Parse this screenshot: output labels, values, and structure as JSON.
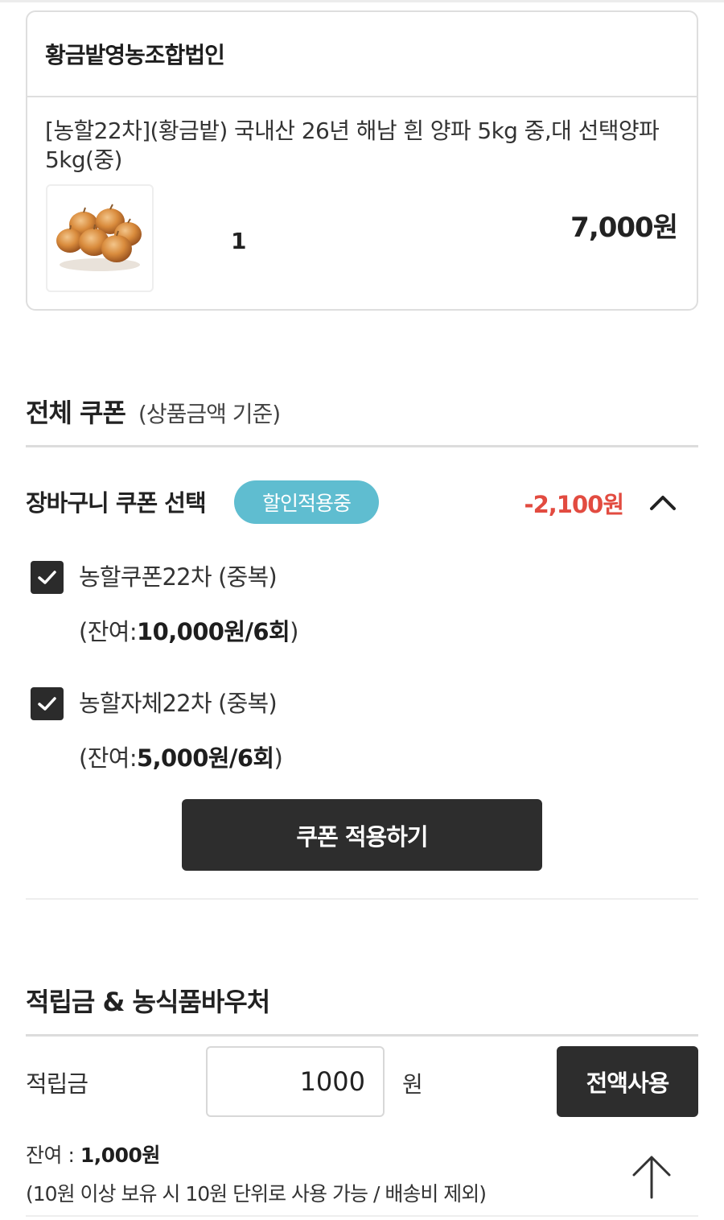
{
  "seller": {
    "name": "황금밭영농조합법인"
  },
  "product": {
    "name": "[농할22차](황금밭) 국내산 26년 해남 흰 양파 5kg 중,대 선택양파 5kg(중)",
    "image_icon": "onion-image",
    "quantity": "1",
    "price": "7,000원"
  },
  "coupon_section": {
    "title": "전체 쿠폰",
    "subtitle": "(상품금액 기준)",
    "cart_coupon_label": "장바구니 쿠폰 선택",
    "badge": "할인적용중",
    "badge_color": "#5fbdd0",
    "discount": "-2,100원",
    "discount_color": "#e24b40",
    "coupons": [
      {
        "name": "농할쿠폰22차 (중복)",
        "bal_prefix": "(잔여:",
        "bal_value": "10,000원/6회",
        "bal_suffix": ")",
        "checked": true
      },
      {
        "name": "농할자체22차 (중복)",
        "bal_prefix": "(잔여:",
        "bal_value": "5,000원/6회",
        "bal_suffix": ")",
        "checked": true
      }
    ],
    "apply_button": "쿠폰 적용하기"
  },
  "points_section": {
    "title": "적립금 & 농식품바우처",
    "label": "적립금",
    "input_value": "1000",
    "unit": "원",
    "full_use_button": "전액사용",
    "balance_prefix": "잔여 : ",
    "balance_value": "1,000원",
    "note": "(10원 이상 보유 시 10원 단위로 사용 가능 / 배송비 제외)"
  },
  "colors": {
    "dark_button": "#2d2d2d",
    "border": "#dedede"
  }
}
